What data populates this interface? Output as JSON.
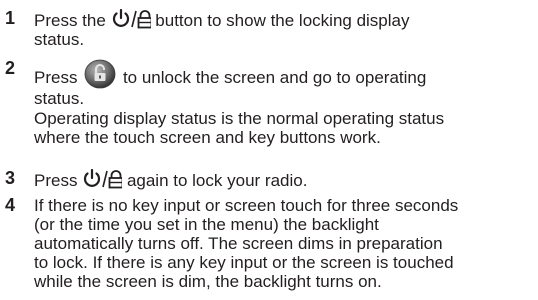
{
  "steps": [
    {
      "number": "1",
      "line1_pre": "Press the",
      "line1_post": "button to show the locking display",
      "line2": "status."
    },
    {
      "number": "2",
      "line1_pre": "Press",
      "line1_post": "to unlock the screen and go to operating",
      "line2": "status.",
      "extra_line1": "Operating display status is the normal operating status",
      "extra_line2": "where the touch screen and key buttons work."
    },
    {
      "number": "3",
      "line1_pre": "Press",
      "line1_post": "again to lock your radio."
    },
    {
      "number": "4",
      "lines": [
        "If there is no key input or screen touch for three seconds",
        "(or the time you set in the menu) the backlight",
        "automatically turns off. The screen dims in preparation",
        "to lock. If there is any key input or the screen is touched",
        "while the screen is dim, the backlight turns on."
      ]
    }
  ],
  "icons": {
    "power_lock": "power-lock-icon",
    "unlock_button": "unlock-button-icon"
  }
}
